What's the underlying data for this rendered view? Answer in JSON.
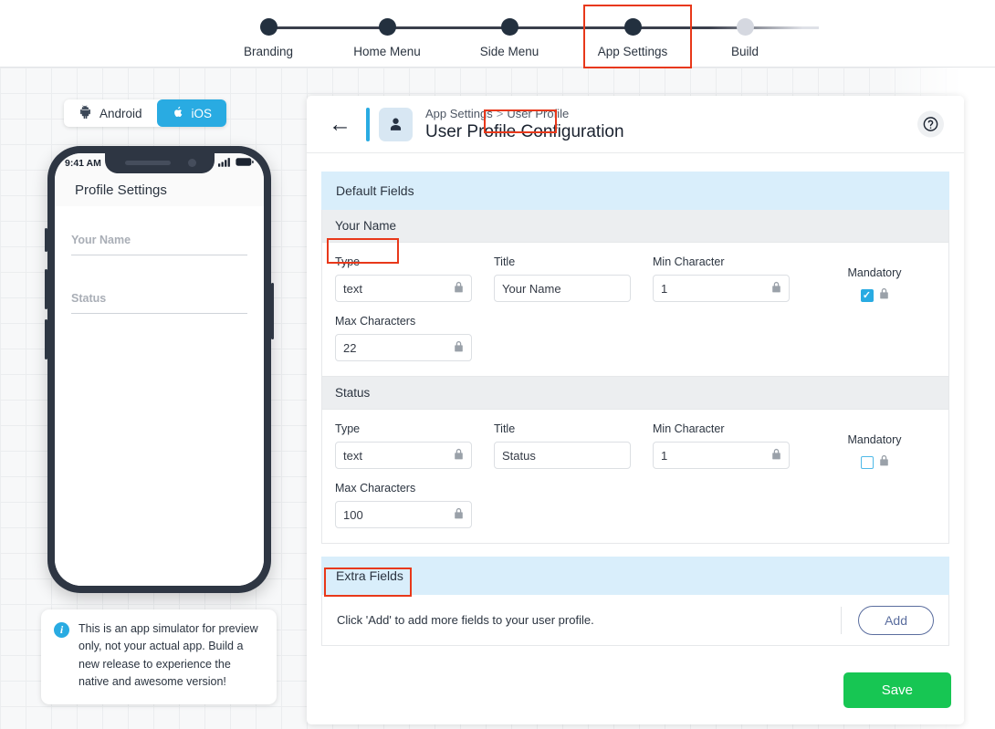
{
  "stepper": {
    "steps": [
      {
        "label": "Branding",
        "state": "done"
      },
      {
        "label": "Home Menu",
        "state": "done"
      },
      {
        "label": "Side Menu",
        "state": "done"
      },
      {
        "label": "App Settings",
        "state": "current"
      },
      {
        "label": "Build",
        "state": "inactive"
      }
    ],
    "highlight_color": "#e8381a"
  },
  "platform_toggle": {
    "android_label": "Android",
    "ios_label": "iOS",
    "active": "iOS",
    "active_color": "#29abe2"
  },
  "phone_preview": {
    "status_time": "9:41 AM",
    "screen_title": "Profile Settings",
    "fields": [
      {
        "placeholder": "Your Name"
      },
      {
        "placeholder": "Status"
      }
    ]
  },
  "info_card": {
    "text": "This is an app simulator for preview only, not your actual app. Build a new release to experience the native and awesome version!"
  },
  "panel": {
    "breadcrumb": {
      "parent": "App Settings",
      "separator": ">",
      "current": "User Profile"
    },
    "title": "User Profile Configuration",
    "help_glyph": "?",
    "accent_color": "#29abe2"
  },
  "sections": {
    "default_fields_label": "Default Fields",
    "extra_fields_label": "Extra Fields"
  },
  "field_groups": [
    {
      "name": "Your Name",
      "labels": {
        "type": "Type",
        "title": "Title",
        "min": "Min Character",
        "max": "Max Characters",
        "mandatory": "Mandatory"
      },
      "values": {
        "type": "text",
        "title": "Your Name",
        "min": "1",
        "max": "22"
      },
      "locked": {
        "type": true,
        "title": false,
        "min": true,
        "max": true,
        "mandatory": true
      },
      "mandatory_checked": true
    },
    {
      "name": "Status",
      "labels": {
        "type": "Type",
        "title": "Title",
        "min": "Min Character",
        "max": "Max Characters",
        "mandatory": "Mandatory"
      },
      "values": {
        "type": "text",
        "title": "Status",
        "min": "1",
        "max": "100"
      },
      "locked": {
        "type": true,
        "title": false,
        "min": true,
        "max": true,
        "mandatory": true
      },
      "mandatory_checked": false
    }
  ],
  "extra_fields_row": {
    "hint": "Click 'Add' to add more fields to your user profile.",
    "add_label": "Add"
  },
  "footer": {
    "save_label": "Save",
    "save_color": "#17c653"
  }
}
